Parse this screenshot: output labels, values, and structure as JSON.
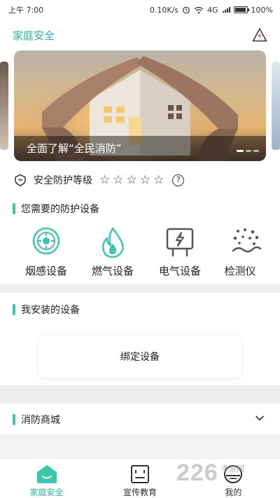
{
  "status_bar": {
    "time": "上午 7:00",
    "network_speed": "0.10K/s",
    "network_type": "4G",
    "battery": "100%"
  },
  "header": {
    "title": "家庭安全",
    "alert_icon": "warning-triangle-icon"
  },
  "banner": {
    "caption": "全面了解“全民消防”",
    "slide_count": 3,
    "active_slide": 1
  },
  "safety_level": {
    "label": "安全防护等级",
    "stars_total": 5,
    "stars_filled": 0,
    "help_icon": "question-circle-icon",
    "help_text": "?"
  },
  "needed_devices": {
    "title": "您需要的防护设备",
    "items": [
      {
        "label": "烟感设备",
        "icon": "smoke-detector-icon"
      },
      {
        "label": "燃气设备",
        "icon": "flame-icon"
      },
      {
        "label": "电气设备",
        "icon": "electric-board-icon"
      },
      {
        "label": "检测仪",
        "icon": "particle-detector-icon"
      }
    ]
  },
  "installed_devices": {
    "title": "我安装的设备",
    "bind_button": "绑定设备"
  },
  "shop": {
    "title": "消防商城",
    "expand_icon": "chevron-down-icon"
  },
  "bottom_nav": {
    "items": [
      {
        "label": "家庭安全",
        "icon": "home-shield-icon",
        "active": true
      },
      {
        "label": "宣传教育",
        "icon": "education-board-icon",
        "active": false
      },
      {
        "label": "我的",
        "icon": "profile-icon",
        "active": false
      }
    ]
  },
  "watermark": {
    "number": "226",
    "text": "手游网"
  },
  "colors": {
    "accent": "#27b9a1",
    "section_bar": "#3cc7ad"
  }
}
